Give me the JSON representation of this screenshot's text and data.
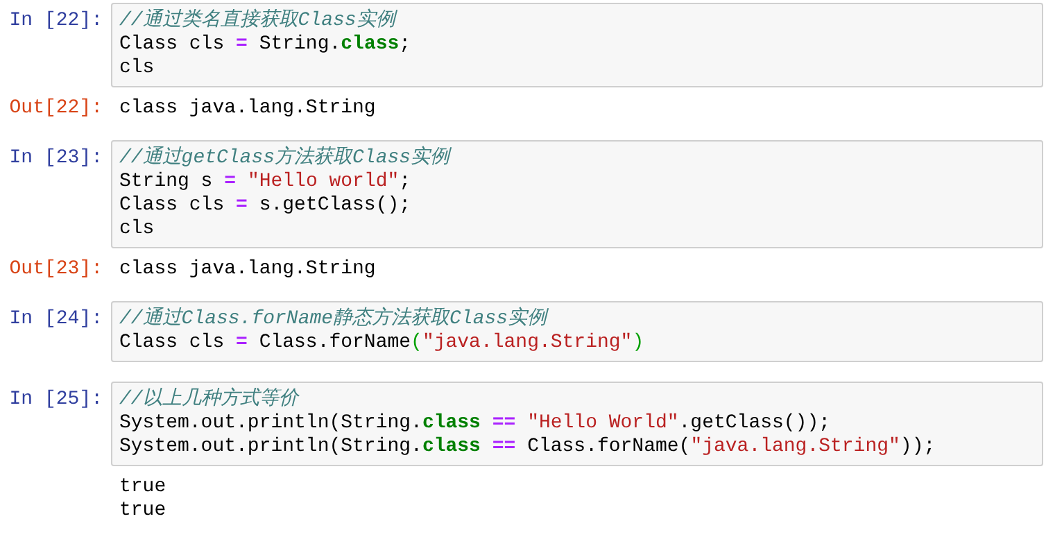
{
  "cells": [
    {
      "prompt": "In [22]:",
      "lines": [
        [
          {
            "kind": "comment",
            "text": "//通过类名直接获取Class实例"
          }
        ],
        [
          {
            "kind": "plain",
            "text": "Class cls "
          },
          {
            "kind": "operator",
            "text": "="
          },
          {
            "kind": "plain",
            "text": " String."
          },
          {
            "kind": "keyword",
            "text": "class"
          },
          {
            "kind": "plain",
            "text": ";"
          }
        ],
        [
          {
            "kind": "plain",
            "text": "cls"
          }
        ]
      ],
      "output": {
        "prompt": "Out[22]:",
        "lines": [
          "class java.lang.String"
        ]
      }
    },
    {
      "prompt": "In [23]:",
      "lines": [
        [
          {
            "kind": "comment",
            "text": "//通过getClass方法获取Class实例"
          }
        ],
        [
          {
            "kind": "plain",
            "text": "String s "
          },
          {
            "kind": "operator",
            "text": "= "
          },
          {
            "kind": "string",
            "text": "\"Hello world\""
          },
          {
            "kind": "plain",
            "text": ";"
          }
        ],
        [
          {
            "kind": "plain",
            "text": "Class cls "
          },
          {
            "kind": "operator",
            "text": "="
          },
          {
            "kind": "plain",
            "text": " s.getClass();"
          }
        ],
        [
          {
            "kind": "plain",
            "text": "cls"
          }
        ]
      ],
      "output": {
        "prompt": "Out[23]:",
        "lines": [
          "class java.lang.String"
        ]
      }
    },
    {
      "prompt": "In [24]:",
      "lines": [
        [
          {
            "kind": "comment",
            "text": "//通过Class.forName静态方法获取Class实例"
          }
        ],
        [
          {
            "kind": "plain",
            "text": "Class cls "
          },
          {
            "kind": "operator",
            "text": "="
          },
          {
            "kind": "plain",
            "text": " Class.forName"
          },
          {
            "kind": "bracket",
            "text": "("
          },
          {
            "kind": "string",
            "text": "\"java.lang.String\""
          },
          {
            "kind": "bracket",
            "text": ")"
          }
        ]
      ]
    },
    {
      "prompt": "In [25]:",
      "lines": [
        [
          {
            "kind": "comment",
            "text": "//以上几种方式等价"
          }
        ],
        [
          {
            "kind": "plain",
            "text": "System.out.println(String."
          },
          {
            "kind": "keyword",
            "text": "class"
          },
          {
            "kind": "operator",
            "text": " == "
          },
          {
            "kind": "string",
            "text": "\"Hello World\""
          },
          {
            "kind": "plain",
            "text": ".getClass());"
          }
        ],
        [
          {
            "kind": "plain",
            "text": "System.out.println(String."
          },
          {
            "kind": "keyword",
            "text": "class"
          },
          {
            "kind": "operator",
            "text": " == "
          },
          {
            "kind": "plain",
            "text": "Class.forName("
          },
          {
            "kind": "string",
            "text": "\"java.lang.String\""
          },
          {
            "kind": "plain",
            "text": "));"
          }
        ]
      ],
      "output": {
        "lines": [
          "true",
          "true"
        ]
      }
    }
  ]
}
